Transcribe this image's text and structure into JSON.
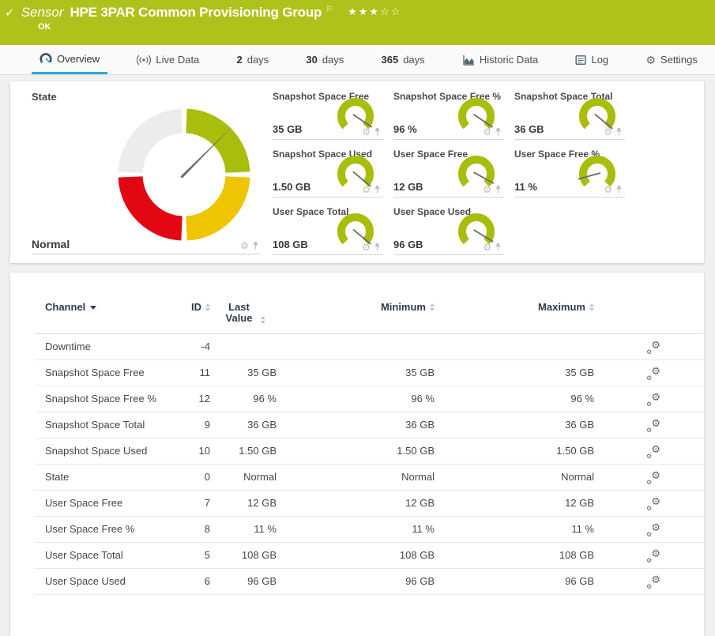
{
  "colors": {
    "brand_green": "#afc21b",
    "accent_blue": "#2da9e0",
    "gauge_green": "#a9bd0d",
    "gauge_yellow": "#efc400",
    "gauge_red": "#e30613",
    "gauge_gray": "#ececec",
    "needle_gray": "#6b6b6b"
  },
  "header": {
    "kicker": "Sensor",
    "title": "HPE 3PAR Common Provisioning Group",
    "status": "OK",
    "rating_filled": 3,
    "rating_total": 5
  },
  "tabs": [
    {
      "label": "Overview",
      "icon": "gauge-icon",
      "active": true
    },
    {
      "label": "Live Data",
      "icon": "broadcast-icon"
    },
    {
      "bold": "2",
      "label": "days"
    },
    {
      "bold": "30",
      "label": "days"
    },
    {
      "bold": "365",
      "label": "days"
    },
    {
      "label": "Historic Data",
      "icon": "chart-icon"
    },
    {
      "label": "Log",
      "icon": "log-icon"
    },
    {
      "label": "Settings",
      "icon": "gear-icon"
    }
  ],
  "state_gauge": {
    "title": "State",
    "value": "Normal",
    "needle_angle_deg": 45,
    "segments": [
      "gray",
      "green",
      "yellow",
      "red"
    ]
  },
  "mini_gauges": [
    {
      "title": "Snapshot Space Free",
      "value": "35 GB",
      "fraction": 0.96
    },
    {
      "title": "Snapshot Space Free %",
      "value": "96 %",
      "fraction": 0.96
    },
    {
      "title": "Snapshot Space Total",
      "value": "36 GB",
      "fraction": 0.98
    },
    {
      "title": "Snapshot Space Used",
      "value": "1.50 GB",
      "fraction": 0.98
    },
    {
      "title": "User Space Free",
      "value": "12 GB",
      "fraction": 0.94
    },
    {
      "title": "User Space Free %",
      "value": "11 %",
      "fraction": 0.11
    },
    {
      "title": "User Space Total",
      "value": "108 GB",
      "fraction": 0.98
    },
    {
      "title": "User Space Used",
      "value": "96 GB",
      "fraction": 0.95
    }
  ],
  "table": {
    "columns": [
      "Channel",
      "ID",
      "Last Value",
      "Minimum",
      "Maximum"
    ],
    "rows": [
      {
        "channel": "Downtime",
        "id": "-4",
        "last": "",
        "min": "",
        "max": ""
      },
      {
        "channel": "Snapshot Space Free",
        "id": "11",
        "last": "35 GB",
        "min": "35 GB",
        "max": "35 GB"
      },
      {
        "channel": "Snapshot Space Free %",
        "id": "12",
        "last": "96 %",
        "min": "96 %",
        "max": "96 %"
      },
      {
        "channel": "Snapshot Space Total",
        "id": "9",
        "last": "36 GB",
        "min": "36 GB",
        "max": "36 GB"
      },
      {
        "channel": "Snapshot Space Used",
        "id": "10",
        "last": "1.50 GB",
        "min": "1.50 GB",
        "max": "1.50 GB"
      },
      {
        "channel": "State",
        "id": "0",
        "last": "Normal",
        "min": "Normal",
        "max": "Normal"
      },
      {
        "channel": "User Space Free",
        "id": "7",
        "last": "12 GB",
        "min": "12 GB",
        "max": "12 GB"
      },
      {
        "channel": "User Space Free %",
        "id": "8",
        "last": "11 %",
        "min": "11 %",
        "max": "11 %"
      },
      {
        "channel": "User Space Total",
        "id": "5",
        "last": "108 GB",
        "min": "108 GB",
        "max": "108 GB"
      },
      {
        "channel": "User Space Used",
        "id": "6",
        "last": "96 GB",
        "min": "96 GB",
        "max": "96 GB"
      }
    ]
  }
}
